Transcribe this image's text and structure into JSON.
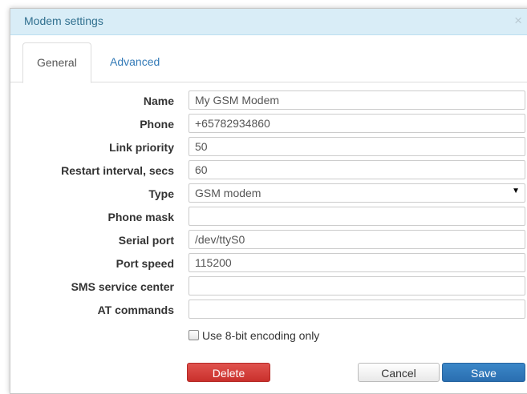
{
  "dialog": {
    "title": "Modem settings",
    "close_glyph": "×"
  },
  "tabs": [
    {
      "label": "General",
      "active": true
    },
    {
      "label": "Advanced",
      "active": false
    }
  ],
  "fields": [
    {
      "label": "Name",
      "value": "My GSM Modem"
    },
    {
      "label": "Phone",
      "value": "+65782934860"
    },
    {
      "label": "Link priority",
      "value": "50"
    },
    {
      "label": "Restart interval, secs",
      "value": "60"
    },
    {
      "label": "Type",
      "value": "GSM modem",
      "is_select": true
    },
    {
      "label": "Phone mask",
      "value": ""
    },
    {
      "label": "Serial port",
      "value": "/dev/ttyS0"
    },
    {
      "label": "Port speed",
      "value": "115200"
    },
    {
      "label": "SMS service center",
      "value": ""
    },
    {
      "label": "AT commands",
      "value": ""
    }
  ],
  "checkbox": {
    "label": "Use 8-bit encoding only",
    "checked": false
  },
  "buttons": {
    "delete": "Delete",
    "cancel": "Cancel",
    "save": "Save"
  },
  "colors": {
    "titlebar": "#d9edf7",
    "delete": "#d43f3a",
    "save": "#337ab7"
  }
}
